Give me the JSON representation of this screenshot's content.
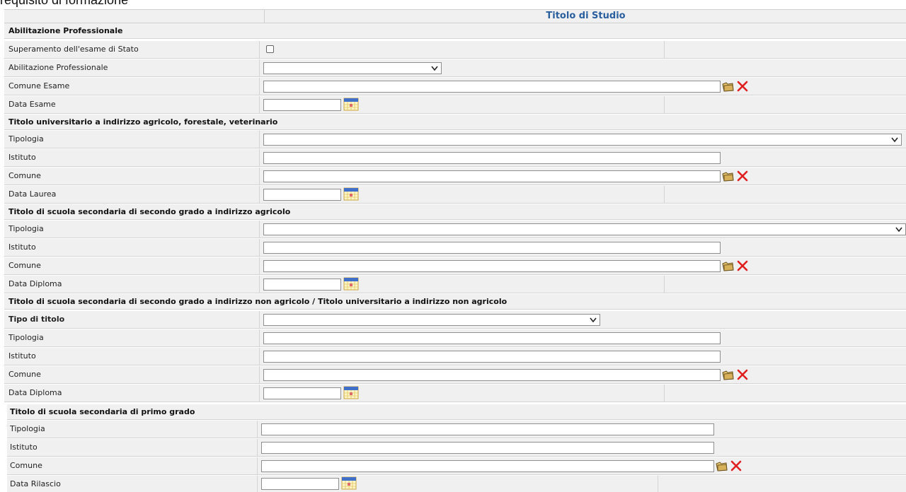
{
  "page_caption": "requisito di formazione",
  "header": {
    "title": "Titolo di Studio"
  },
  "sections": {
    "abilitazione": {
      "title": "Abilitazione Professionale",
      "rows": {
        "esame_stato": "Superamento dell'esame di Stato",
        "abilitazione": "Abilitazione Professionale",
        "comune_esame": "Comune Esame",
        "data_esame": "Data Esame"
      }
    },
    "universitario": {
      "title": "Titolo universitario a indirizzo agricolo, forestale, veterinario",
      "rows": {
        "tipologia": "Tipologia",
        "istituto": "Istituto",
        "comune": "Comune",
        "data": "Data Laurea"
      }
    },
    "secondaria_agricolo": {
      "title": "Titolo di scuola secondaria di secondo grado a indirizzo agricolo",
      "rows": {
        "tipologia": "Tipologia",
        "istituto": "Istituto",
        "comune": "Comune",
        "data": "Data Diploma"
      }
    },
    "non_agricolo": {
      "title": "Titolo di scuola secondaria di secondo grado a indirizzo non agricolo / Titolo universitario a indirizzo non agricolo",
      "rows": {
        "tipo_titolo": "Tipo di titolo",
        "tipologia": "Tipologia",
        "istituto": "Istituto",
        "comune": "Comune",
        "data": "Data Diploma"
      }
    },
    "primo_grado": {
      "title": "Titolo di scuola secondaria di primo grado",
      "rows": {
        "tipologia": "Tipologia",
        "istituto": "Istituto",
        "comune": "Comune",
        "data": "Data Rilascio"
      }
    }
  },
  "icons": {
    "search": "folder-search-icon",
    "clear": "clear-x-icon",
    "calendar": "calendar-icon"
  },
  "colors": {
    "header_title": "#2a5f9e",
    "clear_icon": "#e02020"
  }
}
